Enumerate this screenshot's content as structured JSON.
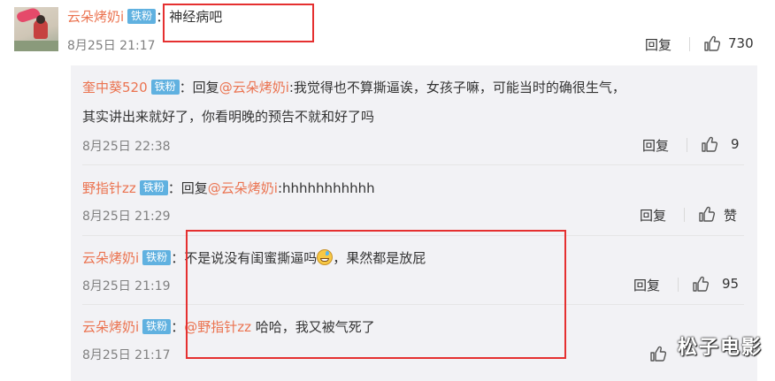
{
  "main_comment": {
    "username": "云朵烤奶i",
    "badge": "铁粉",
    "colon": "：",
    "text": "神经病吧",
    "time": "8月25日 21:17",
    "reply_label": "回复",
    "likes": "730"
  },
  "replies": [
    {
      "username": "奎中葵520",
      "badge": "铁粉",
      "colon": "：",
      "reply_word": "回复",
      "mention": "@云朵烤奶i",
      "text_line1": ":我觉得也不算撕逼诶，女孩子嘛，可能当时的确很生气，",
      "text_line2": "其实讲出来就好了，你看明晚的预告不就和好了吗",
      "time": "8月25日 22:38",
      "reply_label": "回复",
      "likes": "9"
    },
    {
      "username": "野指针zz",
      "badge": "铁粉",
      "colon": "：",
      "reply_word": "回复",
      "mention": "@云朵烤奶i",
      "text": ":hhhhhhhhhhh",
      "time": "8月25日 21:29",
      "reply_label": "回复",
      "likes": "赞"
    },
    {
      "username": "云朵烤奶i",
      "badge": "铁粉",
      "colon": "：",
      "text_before": "不是说没有闺蜜撕逼吗",
      "emoji": "grinning-sweat-emoji",
      "text_after": "，果然都是放屁",
      "time": "8月25日 21:19",
      "reply_label": "回复",
      "likes": "95"
    },
    {
      "username": "云朵烤奶i",
      "badge": "铁粉",
      "colon": "：",
      "mention": "@野指针zz",
      "text": " 哈哈，我又被气死了",
      "time": "8月25日 21:17"
    }
  ],
  "watermark": "松子电影",
  "colors": {
    "username": "#eb7350",
    "badge": "#60b1e0",
    "highlight_box": "#e53030",
    "reply_panel": "#f2f2f5"
  }
}
